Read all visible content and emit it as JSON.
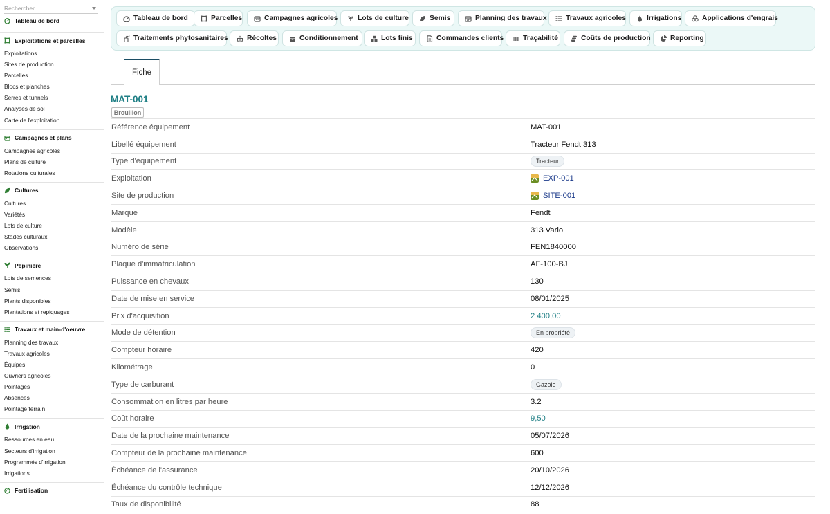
{
  "search": {
    "placeholder": "Rechercher"
  },
  "sidebar": {
    "groups": [
      {
        "title": "Tableau de bord",
        "icon": "dashboard-icon",
        "items": []
      },
      {
        "title": "Exploitations et parcelles",
        "icon": "parcel-icon",
        "items": [
          "Exploitations",
          "Sites de production",
          "Parcelles",
          "Blocs et planches",
          "Serres et tunnels",
          "Analyses de sol",
          "Carte de l'exploitation"
        ]
      },
      {
        "title": "Campagnes et plans",
        "icon": "calendar-icon",
        "items": [
          "Campagnes agricoles",
          "Plans de culture",
          "Rotations culturales"
        ]
      },
      {
        "title": "Cultures",
        "icon": "leaf-icon",
        "items": [
          "Cultures",
          "Variétés",
          "Lots de culture",
          "Stades culturaux",
          "Observations"
        ]
      },
      {
        "title": "Pépinière",
        "icon": "sprout-icon",
        "items": [
          "Lots de semences",
          "Semis",
          "Plants disponibles",
          "Plantations et repiquages"
        ]
      },
      {
        "title": "Travaux et main-d'oeuvre",
        "icon": "list-icon",
        "items": [
          "Planning des travaux",
          "Travaux agricoles",
          "Équipes",
          "Ouvriers agricoles",
          "Pointages",
          "Absences",
          "Pointage terrain"
        ]
      },
      {
        "title": "Irrigation",
        "icon": "drop-icon",
        "items": [
          "Ressources en eau",
          "Secteurs d'irrigation",
          "Programmés d'irrigation",
          "Irrigations"
        ]
      },
      {
        "title": "Fertilisation",
        "icon": "fertilizer-icon",
        "items": []
      }
    ]
  },
  "nav": {
    "buttons": [
      {
        "label": "Tableau de bord",
        "icon": "dashboard-icon"
      },
      {
        "label": "Parcelles",
        "icon": "parcel-icon"
      },
      {
        "label": "Campagnes agricoles",
        "icon": "calendar-icon"
      },
      {
        "label": "Lots de culture",
        "icon": "plant-icon"
      },
      {
        "label": "Semis",
        "icon": "leaf-icon"
      },
      {
        "label": "Planning des travaux",
        "icon": "calendar-check-icon"
      },
      {
        "label": "Travaux agricoles",
        "icon": "list-icon"
      },
      {
        "label": "Irrigations",
        "icon": "drop-icon"
      },
      {
        "label": "Applications d'engrais",
        "icon": "flask-icon"
      },
      {
        "label": "Traitements phytosanitaires",
        "icon": "sprayer-icon"
      },
      {
        "label": "Récoltes",
        "icon": "basket-icon"
      },
      {
        "label": "Conditionnement",
        "icon": "box-icon"
      },
      {
        "label": "Lots finis",
        "icon": "boxes-icon"
      },
      {
        "label": "Commandes clients",
        "icon": "document-icon"
      },
      {
        "label": "Traçabilité",
        "icon": "barcode-icon"
      },
      {
        "label": "Coûts de production",
        "icon": "coins-icon"
      },
      {
        "label": "Reporting",
        "icon": "chart-pie-icon"
      }
    ]
  },
  "tabs": {
    "active": "Fiche"
  },
  "record": {
    "title": "MAT-001",
    "status": "Brouillon",
    "fields": [
      {
        "label": "Référence équipement",
        "value": "MAT-001",
        "kind": "text"
      },
      {
        "label": "Libellé équipement",
        "value": "Tracteur Fendt 313",
        "kind": "text"
      },
      {
        "label": "Type d'équipement",
        "value": "Tracteur",
        "kind": "badge"
      },
      {
        "label": "Exploitation",
        "value": "EXP-001",
        "kind": "link"
      },
      {
        "label": "Site de production",
        "value": "SITE-001",
        "kind": "link"
      },
      {
        "label": "Marque",
        "value": "Fendt",
        "kind": "text"
      },
      {
        "label": "Modèle",
        "value": "313 Vario",
        "kind": "text"
      },
      {
        "label": "Numéro de série",
        "value": "FEN1840000",
        "kind": "text"
      },
      {
        "label": "Plaque d'immatriculation",
        "value": "AF-100-BJ",
        "kind": "text"
      },
      {
        "label": "Puissance en chevaux",
        "value": "130",
        "kind": "text"
      },
      {
        "label": "Date de mise en service",
        "value": "08/01/2025",
        "kind": "text"
      },
      {
        "label": "Prix d'acquisition",
        "value": "2 400,00",
        "kind": "num"
      },
      {
        "label": "Mode de détention",
        "value": "En propriété",
        "kind": "badge"
      },
      {
        "label": "Compteur horaire",
        "value": "420",
        "kind": "text"
      },
      {
        "label": "Kilométrage",
        "value": "0",
        "kind": "text"
      },
      {
        "label": "Type de carburant",
        "value": "Gazole",
        "kind": "badge"
      },
      {
        "label": "Consommation en litres par heure",
        "value": "3.2",
        "kind": "text"
      },
      {
        "label": "Coût horaire",
        "value": "9,50",
        "kind": "num"
      },
      {
        "label": "Date de la prochaine maintenance",
        "value": "05/07/2026",
        "kind": "text"
      },
      {
        "label": "Compteur de la prochaine maintenance",
        "value": "600",
        "kind": "text"
      },
      {
        "label": "Échéance de l'assurance",
        "value": "20/10/2026",
        "kind": "text"
      },
      {
        "label": "Échéance du contrôle technique",
        "value": "12/12/2026",
        "kind": "text"
      },
      {
        "label": "Taux de disponibilité",
        "value": "88",
        "kind": "text"
      }
    ]
  },
  "colors": {
    "accent": "#1f7f85",
    "icon_green": "#2e7d32",
    "link": "#1b3a8a",
    "nav_bg": "#ebf8f7"
  }
}
